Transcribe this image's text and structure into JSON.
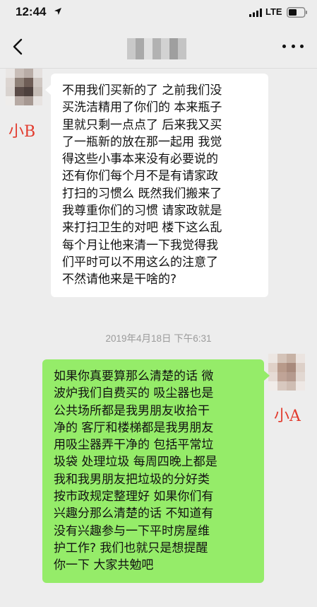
{
  "status_bar": {
    "time": "12:44",
    "network": "LTE",
    "icons": [
      "location-arrow-icon",
      "signal-bars-icon",
      "battery-icon"
    ]
  },
  "header": {
    "back_icon": "chevron-left-icon",
    "more_icon": "ellipsis-icon",
    "name_blurred_colors": [
      "#c9c9c9",
      "#a9a9a9",
      "#e0e0e0",
      "#b2b2b2",
      "#d2d2d2",
      "#9f9f9f",
      "#c4c4c4"
    ]
  },
  "colors": {
    "self_bubble": "#95ec69",
    "other_bubble": "#ffffff",
    "background": "#ededed",
    "annotation": "#e23b2e",
    "timestamp": "#9b9b9b"
  },
  "messages": [
    {
      "side": "left",
      "speaker_label": "小B",
      "avatar_blurred_colors": [
        "#e9e6e4",
        "#c8bdb7",
        "#b8aca6",
        "#e4e0de",
        "#dcd5d1",
        "#8f8178",
        "#6e5d56",
        "#cfc7c2",
        "#d9d3cf",
        "#5b4c48",
        "#4d403d",
        "#c6bdb7",
        "#efedeb",
        "#b7aaa4",
        "#a69892",
        "#e7e3e1"
      ],
      "lines": [
        "不用我们买新的了 之前我们没",
        "买洗洁精用了你们的 本来瓶子",
        "里就只剩一点点了 后来我又买",
        "了一瓶新的放在那一起用 我觉",
        "得这些小事本来没有必要说的",
        "还有你们每个月不是有请家政",
        "打扫的习惯么 既然我们搬来了",
        "我尊重你们的习惯 请家政就是",
        "来打扫卫生的对吧 楼下这么乱",
        "每个月让他来清一下我觉得我",
        "们平时可以不用这么的注意了",
        "不然请他来是干啥的?"
      ]
    },
    {
      "side": "right",
      "speaker_label": "小A",
      "avatar_blurred_colors": [
        "#ece6e2",
        "#d4c3b8",
        "#c7b2a5",
        "#ebe4e0",
        "#e0d1c8",
        "#b89a8a",
        "#a88a7c",
        "#ddd0c8",
        "#e6dbd5",
        "#c0a497",
        "#b59a8e",
        "#e2d8d2",
        "#f1ece9",
        "#d8c8bf",
        "#cfbdb3",
        "#eee8e5"
      ],
      "lines": [
        "如果你真要算那么清楚的话 微",
        "波炉我们自费买的 吸尘器也是",
        "公共场所都是我男朋友收拾干",
        "净的 客厅和楼梯都是我男朋友",
        "用吸尘器弄干净的 包括平常垃",
        "圾袋 处理垃圾 每周四晚上都是",
        "我和我男朋友把垃圾的分好类",
        "按市政规定整理好 如果你们有",
        "兴趣分那么清楚的话 不知道有",
        "没有兴趣参与一下平时房屋维",
        "护工作? 我们也就只是想提醒",
        "你一下 大家共勉吧"
      ]
    }
  ],
  "timestamp": "2019年4月18日 下午6:31"
}
